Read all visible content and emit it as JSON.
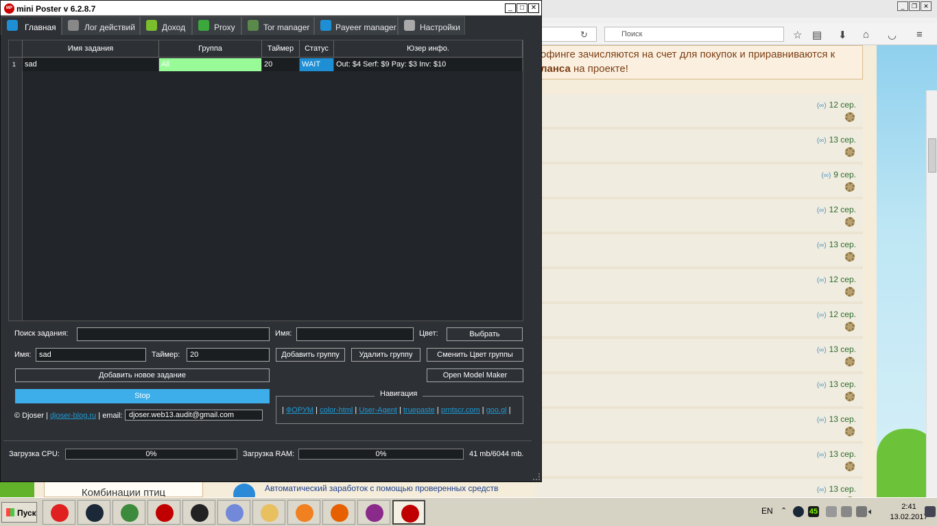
{
  "window": {
    "title": "mini Poster v 6.2.8.7",
    "logo_text": "MP",
    "controls": [
      "_",
      "□",
      "✕"
    ]
  },
  "tabs": [
    {
      "label": "Главная",
      "icon": "globe-icon",
      "color": "#1e8fd5"
    },
    {
      "label": "Лог действий",
      "icon": "document-icon",
      "color": "#888888"
    },
    {
      "label": "Доход",
      "icon": "money-icon",
      "color": "#7cbf2c"
    },
    {
      "label": "Proxy",
      "icon": "proxy-icon",
      "color": "#3ca83c"
    },
    {
      "label": "Tor manager",
      "icon": "tor-icon",
      "color": "#5a8a4a"
    },
    {
      "label": "Payeer manager",
      "icon": "payeer-icon",
      "color": "#1e8fd5"
    },
    {
      "label": "Настройки",
      "icon": "gear-icon",
      "color": "#aaaaaa"
    }
  ],
  "table": {
    "columns": [
      "Имя задания",
      "Группа",
      "Таймер",
      "Статус",
      "Юзер инфо."
    ],
    "rows": [
      {
        "num": "1",
        "name": "sad",
        "group": "All",
        "timer": "20",
        "status": "WAIT",
        "info": "Out: $4 Serf: $9 Pay: $3 Inv: $10"
      }
    ]
  },
  "form": {
    "search_label": "Поиск задания:",
    "search_value": "",
    "name_label": "Имя:",
    "name_value": "",
    "color_label": "Цвет:",
    "choose_button": "Выбрать",
    "task_name_label": "Имя:",
    "task_name_value": "sad",
    "timer_label": "Таймер:",
    "timer_value": "20",
    "add_group_button": "Добавить группу",
    "delete_group_button": "Удалить группу",
    "change_color_button": "Сменить Цвет группы",
    "add_task_button": "Добавить новое задание",
    "open_model_button": "Open Model Maker",
    "stop_button": "Stop"
  },
  "navigation": {
    "title": "Навигация",
    "links": [
      "ФОРУМ",
      "color-html",
      "User-Agent",
      "truepaste",
      "prntscr.com",
      "goo.gl"
    ]
  },
  "footer": {
    "copyright": "© Djoser",
    "site_link": "djoser-blog.ru",
    "email_label": "email:",
    "email_value": "djoser.web13.audit@gmail.com"
  },
  "status": {
    "cpu_label": "Загрузка CPU:",
    "cpu_value": "0%",
    "cpu_fraction": 0,
    "ram_label": "Загрузка RAM:",
    "ram_value": "0%",
    "ram_fraction": 0,
    "memory_text": "41 mb/6044 mb."
  },
  "browser": {
    "search_placeholder": "Поиск",
    "notice_line1": "офинге зачисляются на счет для покупок и приравниваются к",
    "notice_line2_bold": "ланса",
    "notice_line2_rest": " на проекте!",
    "feed_dates": [
      "12 сер.",
      "13 сер.",
      "9 сер.",
      "12 сер.",
      "13 сер.",
      "12 сер.",
      "12 сер.",
      "13 сер.",
      "13 сер.",
      "13 сер.",
      "13 сер.",
      "13 сер."
    ],
    "feed_icon": "(∞)",
    "ad_box_text": "Комбинации птиц",
    "ad_text": "Автоматический заработок с помощью проверенных средств"
  },
  "taskbar": {
    "start_label": "Пуск",
    "apps": [
      {
        "icon": "yandex-icon",
        "color": "#e02020"
      },
      {
        "icon": "steam-icon",
        "color": "#1b2838"
      },
      {
        "icon": "network-icon",
        "color": "#3c8a3c"
      },
      {
        "icon": "record-icon",
        "color": "#c00000"
      },
      {
        "icon": "obs-icon",
        "color": "#222222"
      },
      {
        "icon": "discord-icon",
        "color": "#7289da"
      },
      {
        "icon": "folder-icon",
        "color": "#e8c060"
      },
      {
        "icon": "media-player-icon",
        "color": "#f08020"
      },
      {
        "icon": "firefox-icon",
        "color": "#e66000"
      },
      {
        "icon": "winrar-icon",
        "color": "#8a2a8a"
      },
      {
        "icon": "miniposter-icon",
        "color": "#c00000"
      }
    ],
    "language": "EN",
    "tray_badge": "45",
    "time": "2:41",
    "date": "13.02.2017"
  }
}
